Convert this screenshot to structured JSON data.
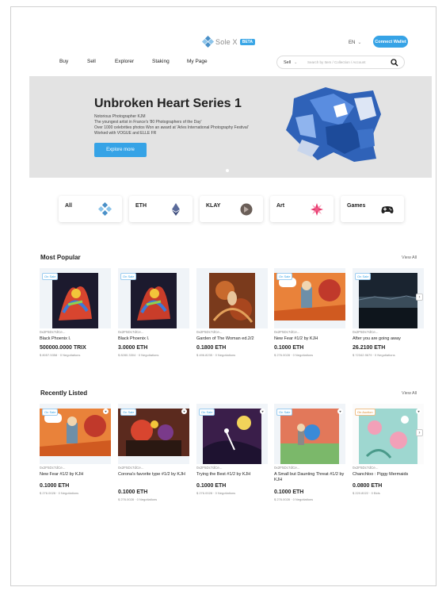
{
  "header": {
    "logo_text": "Sole X",
    "logo_badge": "BETA",
    "lang": "EN",
    "connect_label": "Connect Wallet"
  },
  "nav": [
    "Buy",
    "Sell",
    "Explorer",
    "Staking",
    "My Page"
  ],
  "search": {
    "select_value": "Sell",
    "placeholder": "Search by Item / Collection / Account"
  },
  "hero": {
    "title": "Unbroken Heart Series 1",
    "lines": [
      "Notorious Photographer KJM",
      "The youngest artist in France's '80 Photographers of the Day'",
      "Over 1000 celebrities photos Won an award at 'Arles International Photography Festival'",
      "Worked with VOGUE and ELLE FR"
    ],
    "button": "Explore more"
  },
  "categories": [
    "All",
    "ETH",
    "KLAY",
    "Art",
    "Games"
  ],
  "most_popular": {
    "title": "Most Popular",
    "view_all": "View All",
    "items": [
      {
        "badge": "On Sale",
        "owner": "0x2F5Dc7dCe...",
        "name": "Black Phoenix I.",
        "price": "500000.0000 TRIX",
        "usd": "$ 8057.5358",
        "neg": "0 Negotiations"
      },
      {
        "badge": "On Sale",
        "owner": "0x2F5Dc7dCe...",
        "name": "Black Phoenix I.",
        "price": "3.0000 ETH",
        "usd": "$ 8280.3304",
        "neg": "0 Negotiations"
      },
      {
        "badge": "",
        "owner": "0x2F5Dc7dCe...",
        "name": "Garden of The Woman ed.2/2",
        "price": "0.1800 ETH",
        "usd": "$ 496.8235",
        "neg": "0 Negotiations"
      },
      {
        "badge": "On Sale",
        "owner": "0x2F5Dc7dCe...",
        "name": "New Fear #1/2 by KJH",
        "price": "0.1000 ETH",
        "usd": "$ 276.0028",
        "neg": "0 Negotiations"
      },
      {
        "badge": "On Sale",
        "owner": "0x2F5Dc7dCe...",
        "name": "After you are going away",
        "price": "26.2100 ETH",
        "usd": "$ 72342.9679",
        "neg": "0 Negotiations"
      }
    ]
  },
  "recently_listed": {
    "title": "Recently Listed",
    "view_all": "View All",
    "items": [
      {
        "badge": "On Sale",
        "owner": "0x2F5Dc7dCe...",
        "name": "New Fear #1/2 by KJH",
        "price": "0.1000 ETH",
        "usd": "$ 276.0028",
        "neg": "0 Negotiations"
      },
      {
        "badge": "On Sale",
        "owner": "0x2F5Dc7dCe...",
        "name": "Corona's favorite type #1/2 by KJH",
        "price": "0.1000 ETH",
        "usd": "$ 276.0028",
        "neg": "0 Negotiations"
      },
      {
        "badge": "On Sale",
        "owner": "0x2F5Dc7dCe...",
        "name": "Trying the Best #1/2 by KJH",
        "price": "0.1000 ETH",
        "usd": "$ 276.0028",
        "neg": "0 Negotiations"
      },
      {
        "badge": "On Sale",
        "owner": "0x2F5Dc7dCe...",
        "name": "A Small but Daunting Threat #1/2 by KJH",
        "price": "0.1000 ETH",
        "usd": "$ 276.0028",
        "neg": "0 Negotiations"
      },
      {
        "badge": "On Auction",
        "owner": "0x2F5Dc7dCe...",
        "name": "Chanchloo : Piggy Mermaids",
        "price": "0.0800 ETH",
        "usd": "$ 220.8022",
        "neg": "0 Bids"
      }
    ]
  },
  "colors": {
    "accent": "#36a3e6",
    "hero_bg": "#e3e3e3"
  }
}
